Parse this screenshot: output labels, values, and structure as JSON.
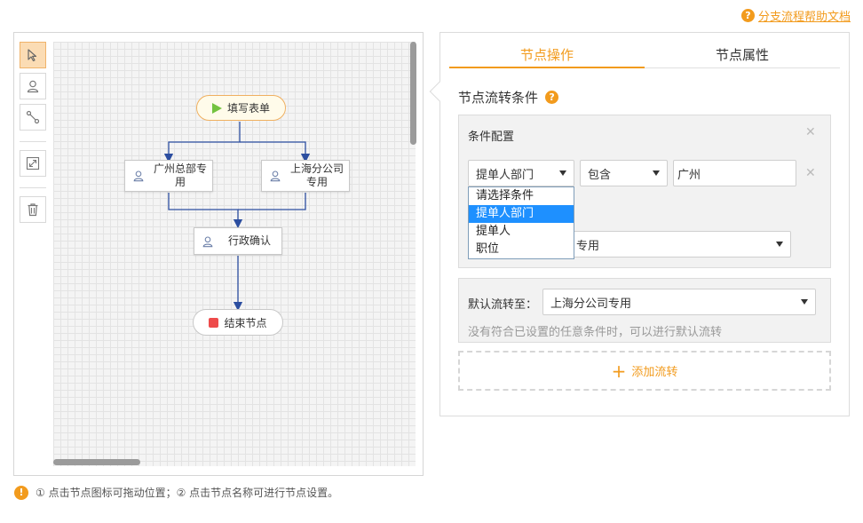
{
  "help": {
    "label": "分支流程帮助文档"
  },
  "flow": {
    "nodes": {
      "start": "填写表单",
      "gz": "广州总部专用",
      "sh": "上海分公司专用",
      "admin": "行政确认",
      "end": "结束节点"
    }
  },
  "tip": {
    "text": "① 点击节点图标可拖动位置；② 点击节点名称可进行节点设置。"
  },
  "tabs": [
    {
      "label": "节点操作",
      "active": true
    },
    {
      "label": "节点属性",
      "active": false
    }
  ],
  "section": {
    "title": "节点流转条件"
  },
  "condition": {
    "title": "条件配置",
    "field_value": "提单人部门",
    "operator_value": "包含",
    "input_value": "广州",
    "target_value_suffix": "专用",
    "dropdown_options": [
      {
        "label": "请选择条件",
        "selected": false
      },
      {
        "label": "提单人部门",
        "selected": true
      },
      {
        "label": "提单人",
        "selected": false
      },
      {
        "label": "职位",
        "selected": false
      }
    ]
  },
  "default_flow": {
    "label": "默认流转至：",
    "value": "上海分公司专用",
    "hint": "没有符合已设置的任意条件时，可以进行默认流转"
  },
  "add_flow": {
    "label": "添加流转"
  },
  "colors": {
    "accent": "#f29b1d",
    "selected": "#1e90ff",
    "connector": "#2c4ea0"
  },
  "icons": [
    "question-icon",
    "pointer-icon",
    "user-icon",
    "connect-icon",
    "expand-icon",
    "trash-icon",
    "play-icon",
    "stop-icon",
    "warning-icon",
    "close-icon",
    "plus-icon",
    "chevron-down-icon"
  ]
}
